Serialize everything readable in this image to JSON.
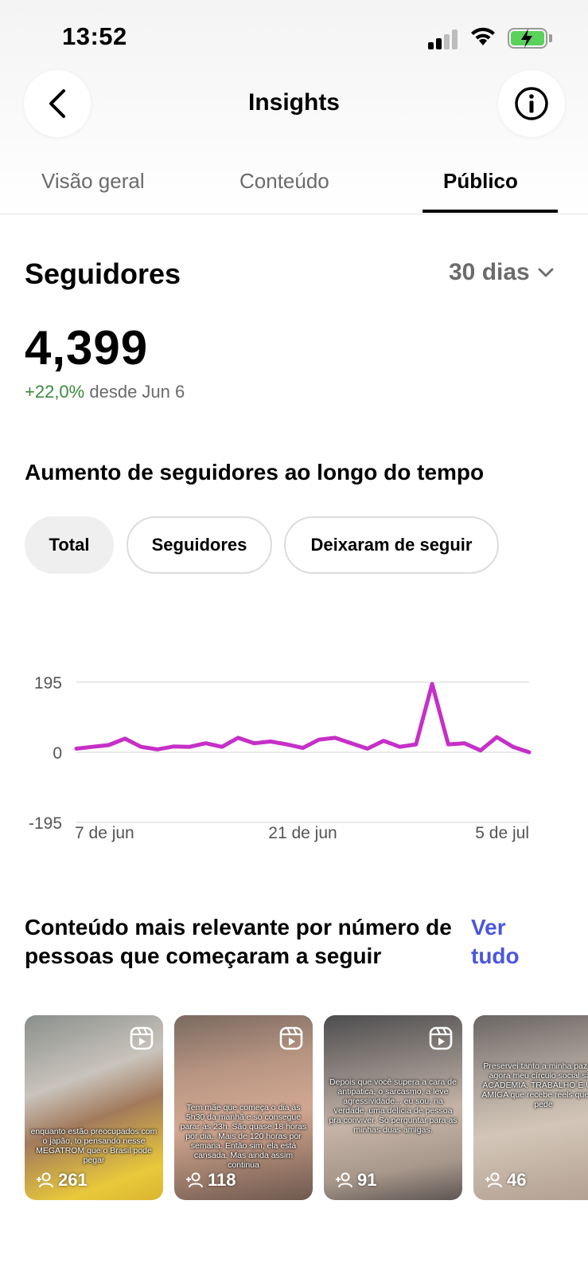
{
  "status_bar": {
    "time": "13:52"
  },
  "nav": {
    "title": "Insights"
  },
  "tabs": [
    {
      "label": "Visão geral",
      "active": false
    },
    {
      "label": "Conteúdo",
      "active": false
    },
    {
      "label": "Público",
      "active": true
    }
  ],
  "followers": {
    "title": "Seguidores",
    "period": "30 dias",
    "total": "4,399",
    "change_pct": "+22,0%",
    "change_since": "desde Jun 6"
  },
  "growth": {
    "heading": "Aumento de seguidores ao longo do tempo",
    "filters": [
      {
        "label": "Total",
        "active": true
      },
      {
        "label": "Seguidores",
        "active": false
      },
      {
        "label": "Deixaram de seguir",
        "active": false
      }
    ]
  },
  "chart_data": {
    "type": "line",
    "x_tick_labels": [
      "7 de jun",
      "21 de jun",
      "5 de jul"
    ],
    "y_tick_labels": [
      "195",
      "0",
      "-195"
    ],
    "ylim": [
      -195,
      195
    ],
    "series": [
      {
        "color": "#c62fc8",
        "values": [
          10,
          15,
          20,
          38,
          15,
          8,
          16,
          15,
          25,
          15,
          40,
          25,
          30,
          22,
          12,
          35,
          40,
          25,
          10,
          32,
          15,
          22,
          190,
          22,
          25,
          5,
          42,
          15,
          0
        ]
      }
    ]
  },
  "top_content": {
    "heading": "Conteúdo mais relevante por número de pessoas que começaram a seguir",
    "see_all": "Ver tudo",
    "items": [
      {
        "caption": "enquanto estão preocupados com o japão, to pensando nesse MEGATROM que o Brasil pode pegar",
        "count": "261"
      },
      {
        "caption": "Tem mãe que começa o dia às 5h30 da manhã e só consegue parar às 23h. São quase 18 horas por dia.. Mais de 120 horas por semana. Então sim, ela está cansada. Mas ainda assim continua",
        "count": "118"
      },
      {
        "caption": "Depois que você supera a cara de antipatica, o sarcasmo, a leve agressividade... eu sou, na verdade, uma delícia de pessoa pra conviver. Só perguntar para as minhas duas amigas.",
        "count": "91"
      },
      {
        "caption": "Preservei tanto a minha paz que agora meu círculo social são: ACADEMIA, TRABALHO E UMA AMIGA que recebe reels que não pede",
        "count": "46"
      }
    ]
  },
  "colors": {
    "accent_link": "#4b56e0",
    "positive": "#3a8a3e",
    "chart_line": "#c62fc8"
  }
}
